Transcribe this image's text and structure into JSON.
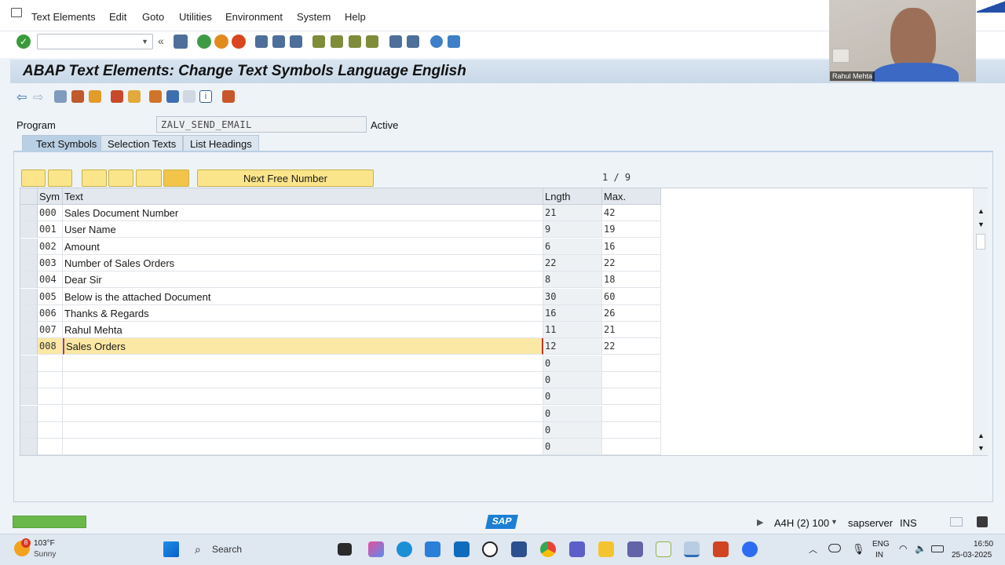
{
  "menu": {
    "items": [
      "Text Elements",
      "Edit",
      "Goto",
      "Utilities",
      "Environment",
      "System",
      "Help"
    ]
  },
  "title": "ABAP Text Elements: Change Text Symbols Language English",
  "program": {
    "label": "Program",
    "value": "ZALV_SEND_EMAIL",
    "status": "Active"
  },
  "tabs": [
    "Text Symbols",
    "Selection Texts",
    "List Headings"
  ],
  "grid_toolbar": {
    "next_free_label": "Next Free Number",
    "page_counter": "1 / 9"
  },
  "grid": {
    "headers": {
      "sym": "Sym",
      "text": "Text",
      "lngth": "Lngth",
      "max": "Max."
    },
    "rows": [
      {
        "sym": "000",
        "text": "Sales Document Number",
        "lngth": "21",
        "max": "42"
      },
      {
        "sym": "001",
        "text": "User Name",
        "lngth": "9",
        "max": "19"
      },
      {
        "sym": "002",
        "text": "Amount",
        "lngth": "6",
        "max": "16"
      },
      {
        "sym": "003",
        "text": "Number of Sales Orders",
        "lngth": "22",
        "max": "22"
      },
      {
        "sym": "004",
        "text": "Dear Sir",
        "lngth": "8",
        "max": "18"
      },
      {
        "sym": "005",
        "text": "Below is the attached Document",
        "lngth": "30",
        "max": "60"
      },
      {
        "sym": "006",
        "text": "Thanks & Regards",
        "lngth": "16",
        "max": "26"
      },
      {
        "sym": "007",
        "text": "Rahul Mehta",
        "lngth": "11",
        "max": "21"
      },
      {
        "sym": "008",
        "text": "Sales Orders",
        "lngth": "12",
        "max": "22"
      },
      {
        "sym": "",
        "text": "",
        "lngth": "0",
        "max": ""
      },
      {
        "sym": "",
        "text": "",
        "lngth": "0",
        "max": ""
      },
      {
        "sym": "",
        "text": "",
        "lngth": "0",
        "max": ""
      },
      {
        "sym": "",
        "text": "",
        "lngth": "0",
        "max": ""
      },
      {
        "sym": "",
        "text": "",
        "lngth": "0",
        "max": ""
      },
      {
        "sym": "",
        "text": "",
        "lngth": "0",
        "max": ""
      }
    ]
  },
  "status": {
    "system": "A4H (2) 100",
    "server": "sapserver",
    "mode": "INS",
    "logo": "SAP"
  },
  "taskbar": {
    "weather_temp": "103°F",
    "weather_desc": "Sunny",
    "weather_badge": "8",
    "search_label": "Search",
    "lang_top": "ENG",
    "lang_bottom": "IN",
    "time": "16:50",
    "date": "25-03-2025"
  },
  "webcam": {
    "name": "Rahul Mehta"
  },
  "colors": {
    "title_bg": "#c9d8e8",
    "highlight_row": "#fbe8a5",
    "yellow_button": "#fbe58a",
    "progress": "#6bb84a",
    "sap_blue": "#1c7fd4"
  }
}
